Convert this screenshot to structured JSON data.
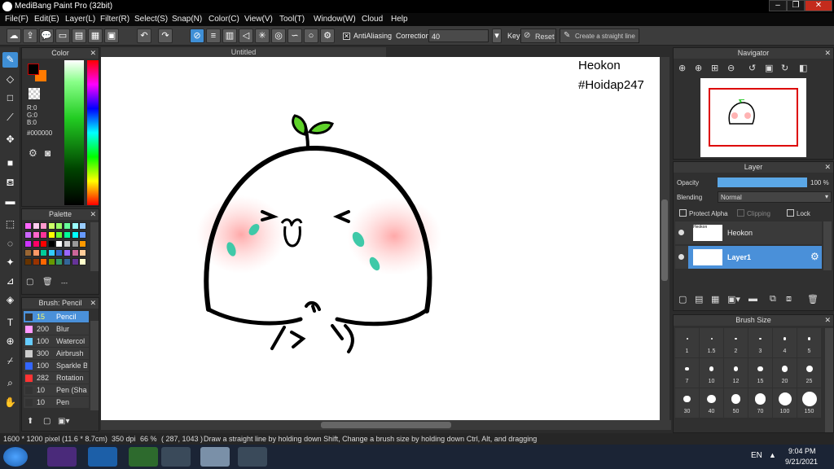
{
  "window": {
    "title": "MediBang Paint Pro (32bit)"
  },
  "menu": [
    "File(F)",
    "Edit(E)",
    "Layer(L)",
    "Filter(R)",
    "Select(S)",
    "Snap(N)",
    "Color(C)",
    "View(V)",
    "Tool(T)",
    "Window(W)",
    "Cloud",
    "Help"
  ],
  "toolbar": {
    "antialias_label": "AntiAliasing",
    "correction_label": "Correction",
    "correction_value": "40",
    "key_label": "Key",
    "reset_label": "Reset",
    "straight_label": "Create a straight line"
  },
  "color_panel": {
    "title": "Color",
    "r": "R:0",
    "g": "G:0",
    "b": "B:0",
    "hex": "#000000",
    "primary": "#000000",
    "secondary": "#ff7a00"
  },
  "palette_panel": {
    "title": "Palette",
    "dash": "---",
    "swatches": [
      "#ff66ff",
      "#ffccee",
      "#ff99cc",
      "#ccff66",
      "#99ff66",
      "#66ff99",
      "#99ffff",
      "#99ccff",
      "#cc66ff",
      "#ff66cc",
      "#ff3399",
      "#ffff00",
      "#66ff33",
      "#00ff99",
      "#00ffff",
      "#6699ff",
      "#cc33ff",
      "#ff0066",
      "#ff0000",
      "#000000",
      "#ffffff",
      "#cccccc",
      "#999999",
      "#ff9900",
      "#996633",
      "#ff9966",
      "#00cc99",
      "#33ccff",
      "#3366cc",
      "#9966ff",
      "#cc6699",
      "#ffcc99",
      "#663300",
      "#993300",
      "#ff6600",
      "#669900",
      "#339966",
      "#336699",
      "#663399",
      "#ffffcc"
    ]
  },
  "brush_panel": {
    "title": "Brush: Pencil",
    "items": [
      {
        "size": "15",
        "name": "Pencil",
        "color": "#333333",
        "sel": true
      },
      {
        "size": "200",
        "name": "Blur",
        "color": "#ff99ff",
        "sel": false
      },
      {
        "size": "100",
        "name": "Watercol",
        "color": "#66ccff",
        "sel": false
      },
      {
        "size": "300",
        "name": "Airbrush",
        "color": "#cccccc",
        "sel": false
      },
      {
        "size": "100",
        "name": "Sparkle B",
        "color": "#3366ff",
        "sel": false
      },
      {
        "size": "282",
        "name": "Rotation",
        "color": "#ff3333",
        "sel": false
      },
      {
        "size": "10",
        "name": "Pen (Sha",
        "color": "#333333",
        "sel": false
      },
      {
        "size": "10",
        "name": "Pen",
        "color": "#333333",
        "sel": false
      }
    ]
  },
  "document": {
    "tab": "Untitled",
    "note_line1": "Heokon",
    "note_line2": "#Hoidap247"
  },
  "navigator_panel": {
    "title": "Navigator"
  },
  "layer_panel": {
    "title": "Layer",
    "opacity_label": "Opacity",
    "opacity_value": "100 %",
    "opacity": 1.0,
    "blending_label": "Blending",
    "blending_value": "Normal",
    "protect_alpha": "Protect Alpha",
    "clipping": "Clipping",
    "lock": "Lock",
    "layers": [
      {
        "name": "Heokon",
        "sel": false
      },
      {
        "name": "Layer1",
        "sel": true
      }
    ]
  },
  "brushsize_panel": {
    "title": "Brush Size",
    "sizes": [
      "1",
      "1.5",
      "2",
      "3",
      "4",
      "5",
      "7",
      "10",
      "12",
      "15",
      "20",
      "25",
      "30",
      "40",
      "50",
      "70",
      "100",
      "150"
    ]
  },
  "status": {
    "size": "1600 * 1200 pixel",
    "cm": "(11.6 * 8.7cm)",
    "dpi": "350 dpi",
    "zoom": "66 %",
    "coords": "( 287, 1043 )",
    "hint": "Draw a straight line by holding down Shift, Change a brush size by holding down Ctrl, Alt, and dragging"
  },
  "taskbar": {
    "lang": "EN",
    "time": "9:04 PM",
    "date": "9/21/2021"
  }
}
